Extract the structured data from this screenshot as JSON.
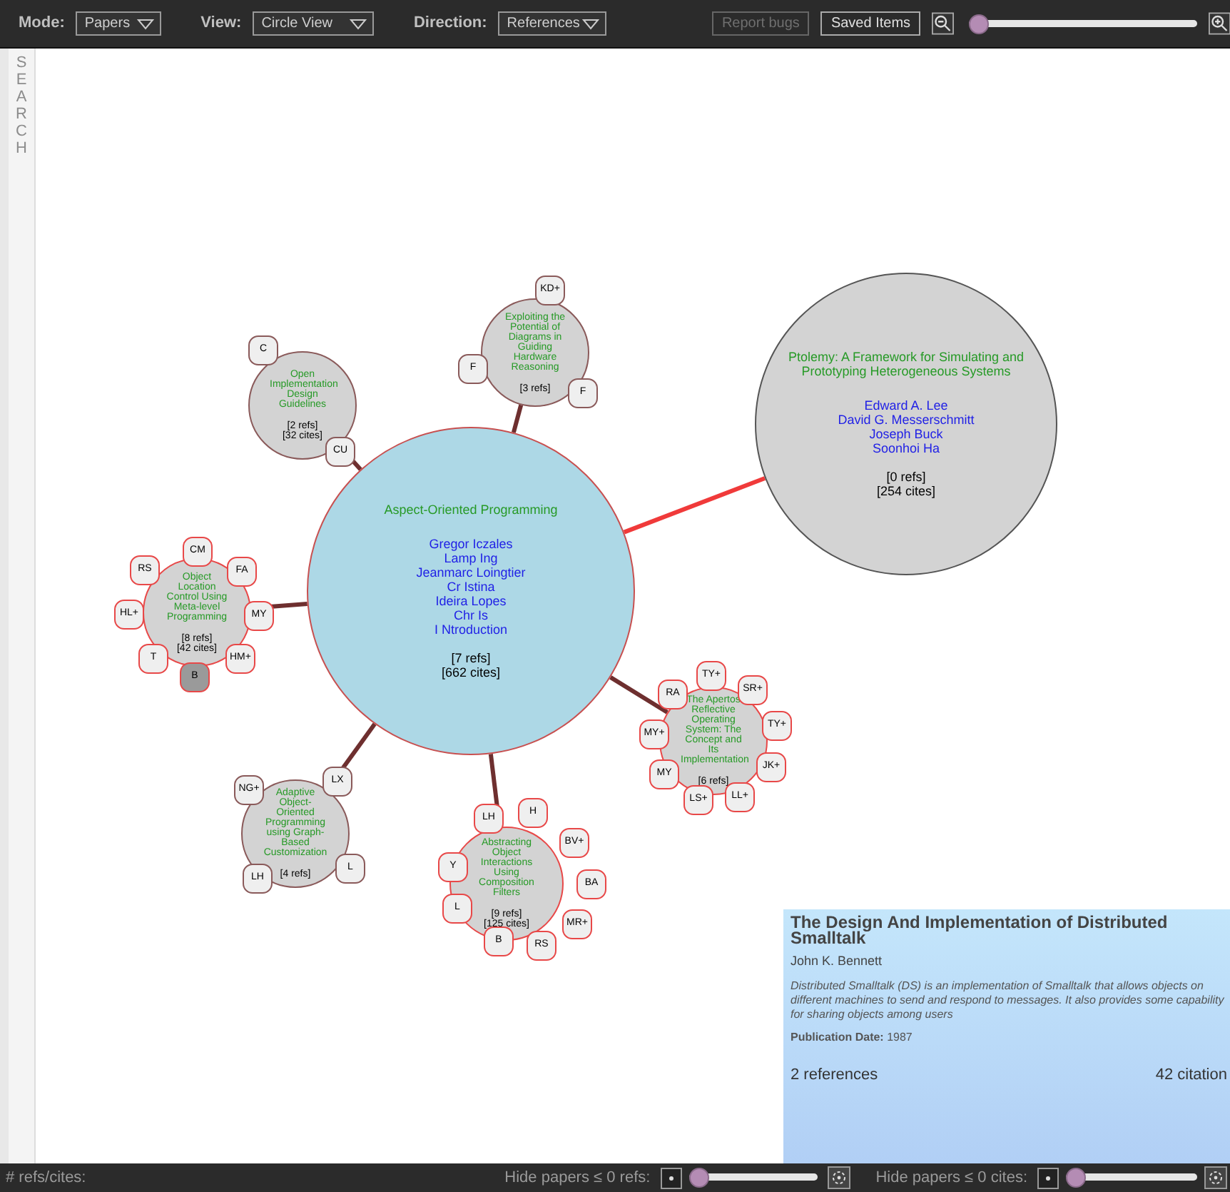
{
  "toolbar": {
    "dropdowns": [
      {
        "label": "Mode:",
        "value": "Papers"
      },
      {
        "label": "View:",
        "value": "Circle View"
      },
      {
        "label": "Direction:",
        "value": "References"
      }
    ],
    "buttons": [
      {
        "label": "Report bugs",
        "disabled": true
      },
      {
        "label": "Saved Items",
        "disabled": false
      }
    ],
    "zoom": {
      "level": 0.0
    }
  },
  "sidebar": {
    "label": "SEARCH"
  },
  "graph": {
    "center": {
      "title": "Aspect-Oriented Programming",
      "authors": [
        "Gregor Iczales",
        "Lamp Ing",
        "Jeanmarc Loingtier",
        "Cr Istina",
        "Ideira Lopes",
        "Chr Is",
        "I Ntroduction"
      ],
      "refs": "[7 refs]",
      "cites": "[662 cites]"
    },
    "papers": [
      {
        "title": "Ptolemy: A Framework for Simulating and Prototyping Heterogeneous Systems",
        "authors": [
          "Edward A. Lee",
          "David G. Messerschmitt",
          "Joseph Buck",
          "Soonhoi Ha"
        ],
        "refs": "[0 refs]",
        "cites": "[254 cites]",
        "color": "#555555",
        "selected": true
      },
      {
        "title": "Open Implementation Design Guidelines",
        "refs": "[2 refs]",
        "cites": "[32 cites]",
        "color": "#8a5a5a",
        "selected": false,
        "tags": [
          {
            "label": "C",
            "selected": false
          },
          {
            "label": "CU",
            "selected": false
          }
        ]
      },
      {
        "title": "Exploiting the Potential of Diagrams in Guiding Hardware Reasoning",
        "refs": "[3 refs]",
        "color": "#8a5a5a",
        "selected": false,
        "tags": [
          {
            "label": "KD+",
            "selected": false
          },
          {
            "label": "F",
            "selected": false
          },
          {
            "label": "F",
            "selected": false
          }
        ]
      },
      {
        "title": "Object Location Control Using Meta-level Programming",
        "refs": "[8 refs]",
        "cites": "[42 cites]",
        "color": "#e84848",
        "selected": false,
        "tags": [
          {
            "label": "CM",
            "selected": false
          },
          {
            "label": "RS",
            "selected": false
          },
          {
            "label": "FA",
            "selected": false
          },
          {
            "label": "HL+",
            "selected": false
          },
          {
            "label": "MY",
            "selected": false
          },
          {
            "label": "T",
            "selected": false
          },
          {
            "label": "HM+",
            "selected": false
          },
          {
            "label": "B",
            "selected": true
          }
        ]
      },
      {
        "title": "The Apertos Reflective Operating System: The Concept and Its Implementation",
        "refs": "[6 refs]",
        "color": "#e84848",
        "selected": false,
        "tags": [
          {
            "label": "TY+",
            "selected": false
          },
          {
            "label": "RA",
            "selected": false
          },
          {
            "label": "SR+",
            "selected": false
          },
          {
            "label": "MY+",
            "selected": false
          },
          {
            "label": "TY+",
            "selected": false
          },
          {
            "label": "MY",
            "selected": false
          },
          {
            "label": "JK+",
            "selected": false
          },
          {
            "label": "LS+",
            "selected": false
          },
          {
            "label": "LL+",
            "selected": false
          }
        ]
      },
      {
        "title": "Adaptive Object-Oriented Programming using Graph-Based Customization",
        "refs": "[4 refs]",
        "color": "#8a5a5a",
        "selected": false,
        "tags": [
          {
            "label": "NG+",
            "selected": false
          },
          {
            "label": "LX",
            "selected": false
          },
          {
            "label": "LH",
            "selected": false
          },
          {
            "label": "L",
            "selected": false
          }
        ]
      },
      {
        "title": "Abstracting Object Interactions Using Composition Filters",
        "refs": "[9 refs]",
        "cites": "[125 cites]",
        "color": "#e84848",
        "selected": false,
        "tags": [
          {
            "label": "LH",
            "selected": false
          },
          {
            "label": "H",
            "selected": false
          },
          {
            "label": "BV+",
            "selected": false
          },
          {
            "label": "Y",
            "selected": false
          },
          {
            "label": "BA",
            "selected": false
          },
          {
            "label": "L",
            "selected": false
          },
          {
            "label": "MR+",
            "selected": false
          },
          {
            "label": "B",
            "selected": false
          },
          {
            "label": "RS",
            "selected": false
          }
        ]
      }
    ]
  },
  "details": {
    "title": "The Design And Implementation of Distributed Smalltalk",
    "author": "John K. Bennett",
    "abstract": "Distributed Smalltalk (DS) is an implementation of Smalltalk that allows objects on different machines to send and respond to messages. It also provides some capability for sharing objects among users",
    "date_label": "Publication Date:",
    "date": "1987",
    "references": "2 references",
    "citations": "42 citation"
  },
  "status_bar": {
    "label": "# refs/cites:",
    "filters": [
      {
        "label": "Hide papers ≤ 0 refs:",
        "level": 0.0
      },
      {
        "label": "Hide papers ≤ 0 cites:",
        "level": 0.0
      }
    ]
  }
}
